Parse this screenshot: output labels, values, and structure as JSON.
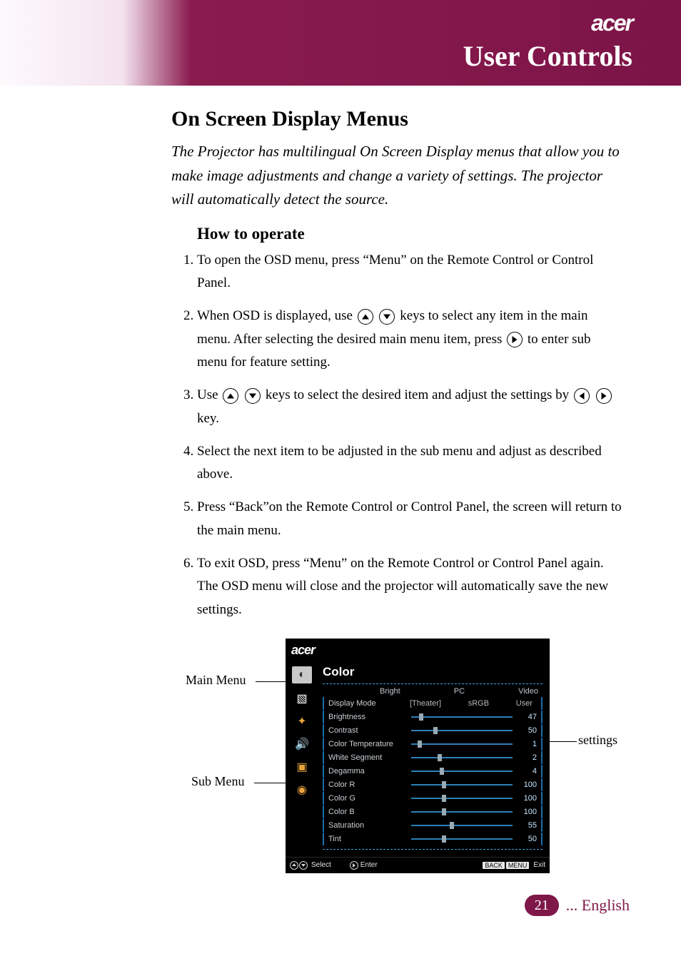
{
  "brand": "acer",
  "header_title": "User Controls",
  "section_title": "On Screen Display Menus",
  "intro": "The Projector has multilingual On Screen Display menus that allow you to make image adjustments and change a variety of settings. The projector will automatically detect the source.",
  "howto_title": "How to operate",
  "steps": {
    "s1": "To open the OSD menu, press “Menu” on the Remote Control or Control Panel.",
    "s2a": "When OSD is displayed, use ",
    "s2b": " keys to select any item in the main menu. After selecting the desired main menu item, press ",
    "s2c": " to enter sub menu for feature setting.",
    "s3a": "Use ",
    "s3b": " keys to select the desired item and adjust the settings by ",
    "s3c": " key.",
    "s4": "Select the next item to be adjusted in the sub menu and adjust as described above.",
    "s5": "Press “Back”on the Remote Control or Control Panel, the screen will return to the main menu.",
    "s6": "To exit OSD, press “Menu” on the Remote Control or Control Panel again. The OSD menu will close and the projector will automatically save the new settings."
  },
  "osd": {
    "logo": "acer",
    "title": "Color",
    "modes1": [
      "Bright",
      "PC",
      "Video"
    ],
    "modes2": [
      "[Theater]",
      "sRGB",
      "User"
    ],
    "rows": [
      {
        "label": "Display Mode",
        "type": "modes"
      },
      {
        "label": "Brightness",
        "val": "47",
        "pos": 8
      },
      {
        "label": "Contrast",
        "val": "50",
        "pos": 22
      },
      {
        "label": "Color Temperature",
        "val": "1",
        "pos": 6
      },
      {
        "label": "White Segment",
        "val": "2",
        "pos": 26
      },
      {
        "label": "Degamma",
        "val": "4",
        "pos": 28
      },
      {
        "label": "Color R",
        "val": "100",
        "pos": 30
      },
      {
        "label": "Color G",
        "val": "100",
        "pos": 30
      },
      {
        "label": "Color B",
        "val": "100",
        "pos": 30
      },
      {
        "label": "Saturation",
        "val": "55",
        "pos": 38
      },
      {
        "label": "Tint",
        "val": "50",
        "pos": 30
      }
    ],
    "bottom": {
      "select": "Select",
      "enter": "Enter",
      "back": "BACK",
      "menu": "MENU",
      "exit": "Exit"
    }
  },
  "callouts": {
    "main": "Main Menu",
    "sub": "Sub Menu",
    "settings": "settings"
  },
  "page_number": "21",
  "language_label": "... English"
}
